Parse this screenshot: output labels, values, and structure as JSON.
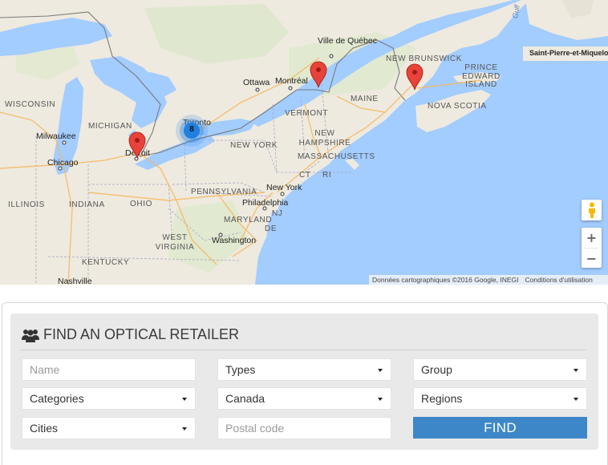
{
  "map": {
    "labels": {
      "wisconsin": "WISCONSIN",
      "michigan": "MICHIGAN",
      "milwaukee": "Milwaukee",
      "chicago": "Chicago",
      "detroit": "Detroit",
      "toronto": "Toronto",
      "ottawa": "Ottawa",
      "montreal": "Montréal",
      "quebec_city": "Ville de Québec",
      "new_brunswick": "NEW BRUNSWICK",
      "pei": "PRINCE EDWARD ISLAND",
      "nova_scotia": "NOVA SCOTIA",
      "saint_pierre": "Saint-Pierre-et-Miquelon",
      "gulf": "Gulf",
      "maine": "MAINE",
      "vermont": "VERMONT",
      "new_hampshire": "NEW HAMPSHIRE",
      "massachusetts": "MASSACHUSETTS",
      "new_york_state": "NEW YORK",
      "ct": "CT",
      "ri": "RI",
      "new_york_city": "New York",
      "pennsylvania": "PENNSYLVANIA",
      "philadelphia": "Philadelphia",
      "nj": "NJ",
      "ohio": "OHIO",
      "indiana": "INDIANA",
      "illinois": "ILLINOIS",
      "maryland": "MARYLAND",
      "de": "DE",
      "washington": "Washington",
      "west_virginia": "WEST VIRGINIA",
      "kentucky": "KENTUCKY",
      "nashville": "Nashville"
    },
    "cluster_count": "8",
    "zoom_in": "+",
    "zoom_out": "−",
    "attribution": "Données cartographiques ©2016 Google, INEGI",
    "terms": "Conditions d'utilisation",
    "colors": {
      "water": "#a3ccff",
      "land": "#eeeadf",
      "marker": "#e8433a",
      "cluster": "#1f80e0"
    }
  },
  "form": {
    "title": "FIND AN OPTICAL RETAILER",
    "title_icon": "users-icon",
    "name_placeholder": "Name",
    "types_label": "Types",
    "group_label": "Group",
    "categories_label": "Categories",
    "country_value": "Canada",
    "regions_label": "Regions",
    "cities_label": "Cities",
    "postal_placeholder": "Postal code",
    "find_label": "FIND",
    "accent_color": "#3d87c8"
  }
}
